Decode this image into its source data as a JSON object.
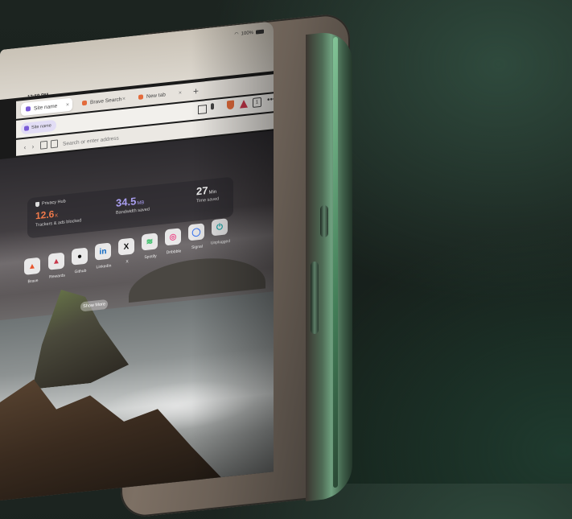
{
  "status_bar": {
    "time": "12:59 PM",
    "battery": "100%"
  },
  "tabs": [
    {
      "label": "Site name",
      "icon_color": "#7a5cd6"
    },
    {
      "label": "Brave Search",
      "icon_color": "#e36b3b"
    },
    {
      "label": "New tab",
      "icon_color": "#e36b3b"
    }
  ],
  "toolbar": {
    "tab_count": "1",
    "menu_glyph": "•••"
  },
  "address_bar": {
    "placeholder": "Search or enter address"
  },
  "privacy_stats": {
    "trackers": {
      "heading": "Privacy Hub",
      "value": "12.6",
      "unit": "K",
      "label": "Trackers & ads blocked"
    },
    "bandwidth": {
      "value": "34.5",
      "unit": "MB",
      "label": "Bandwidth saved"
    },
    "time": {
      "value": "27",
      "unit": "Min",
      "label": "Time saved"
    }
  },
  "top_sites": [
    {
      "label": "Brave",
      "glyph": "▲",
      "color": "#e8552d"
    },
    {
      "label": "Rewards",
      "glyph": "▲",
      "color": "#c8364a"
    },
    {
      "label": "Github",
      "glyph": "●",
      "color": "#111111"
    },
    {
      "label": "LinkedIn",
      "glyph": "in",
      "color": "#0a66c2"
    },
    {
      "label": "X",
      "glyph": "X",
      "color": "#111111"
    },
    {
      "label": "Spotify",
      "glyph": "≋",
      "color": "#1db954"
    },
    {
      "label": "Dribbble",
      "glyph": "◎",
      "color": "#ea4c89"
    },
    {
      "label": "Signal",
      "glyph": "◯",
      "color": "#3a76f0"
    },
    {
      "label": "Unplugged",
      "glyph": "⏻",
      "color": "#1aa3a3"
    }
  ],
  "show_more_label": "Show More",
  "colors": {
    "accent_orange": "#f07a4a",
    "accent_purple": "#a99ef0",
    "frame_green": "#6fa07f"
  }
}
